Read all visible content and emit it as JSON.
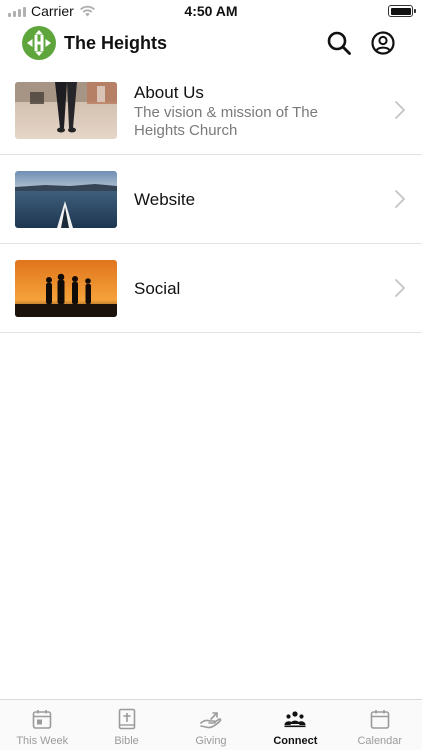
{
  "status_bar": {
    "carrier": "Carrier",
    "time": "4:50 AM",
    "icons": [
      "signal-icon",
      "wifi-icon",
      "battery-icon"
    ]
  },
  "header": {
    "title": "The Heights",
    "logo_icon": "church-logo-icon",
    "search_icon": "search-icon",
    "account_icon": "account-icon",
    "logo_color": "#5ea53c"
  },
  "list": {
    "items": [
      {
        "title": "About Us",
        "subtitle": "The vision & mission of The Heights Church",
        "image": "beach-walk-thumbnail"
      },
      {
        "title": "Website",
        "subtitle": "",
        "image": "kayak-lake-thumbnail"
      },
      {
        "title": "Social",
        "subtitle": "",
        "image": "sunset-friends-thumbnail"
      }
    ]
  },
  "tab_bar": {
    "active_tab": "Connect",
    "tabs": [
      {
        "label": "This Week",
        "icon": "calendar-day-icon"
      },
      {
        "label": "Bible",
        "icon": "bible-icon"
      },
      {
        "label": "Giving",
        "icon": "giving-hand-icon"
      },
      {
        "label": "Connect",
        "icon": "people-group-icon"
      },
      {
        "label": "Calendar",
        "icon": "calendar-icon"
      }
    ],
    "active_color": "#111111",
    "inactive_color": "#9b9b9b"
  }
}
